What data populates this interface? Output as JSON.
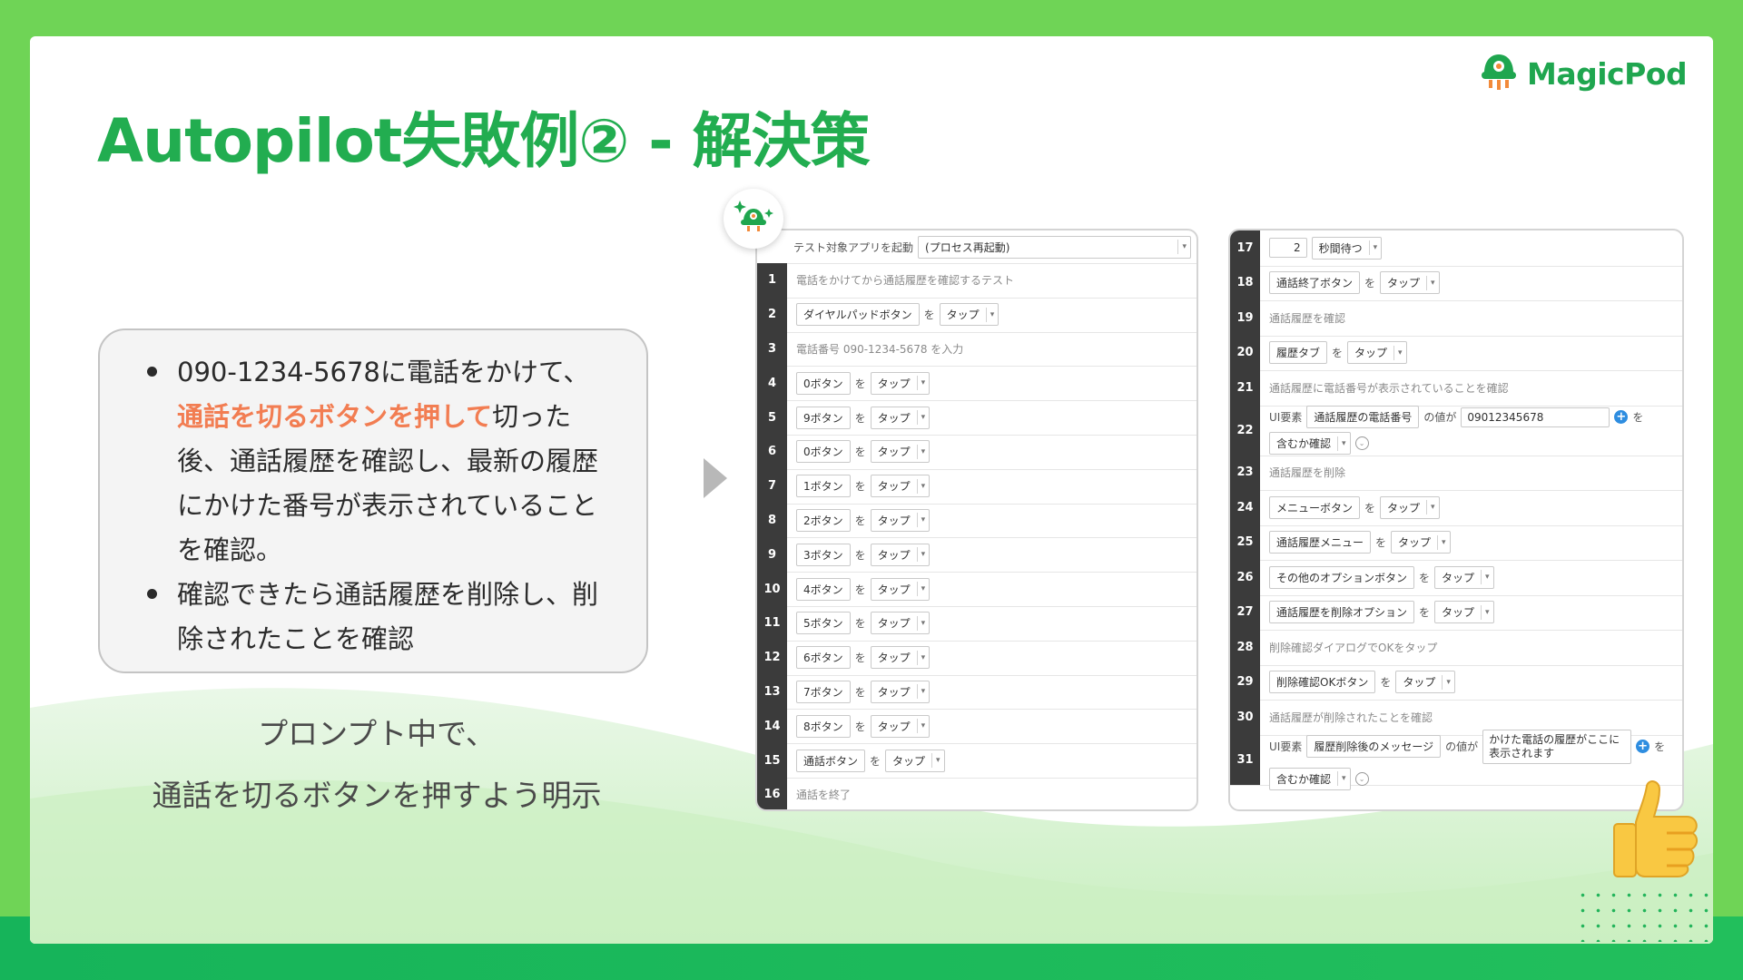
{
  "logo": {
    "text": "MagicPod"
  },
  "title": "Autopilot失敗例② - 解決策",
  "bullets": {
    "b1_pre": "090-1234-5678に電話をかけて、",
    "b1_highlight": "通話を切るボタンを押して",
    "b1_post": "切った後、通話履歴を確認し、最新の履歴にかけた番号が表示されていることを確認。",
    "b2": "確認できたら通話履歴を削除し、削除されたことを確認"
  },
  "caption": {
    "line1": "プロンプト中で、",
    "line2": "通話を切るボタンを押すよう明示"
  },
  "colors": {
    "title_green": "#22ad50",
    "highlight_orange": "#f27d52",
    "bg_green": "#6fd456"
  },
  "left_panel": {
    "launch": {
      "label": "テスト対象アプリを起動",
      "option": "(プロセス再起動)"
    },
    "steps": [
      {
        "n": "1",
        "comment": "電話をかけてから通話履歴を確認するテスト"
      },
      {
        "n": "2",
        "element": "ダイヤルパッドボタン",
        "wo": "を",
        "action": "タップ"
      },
      {
        "n": "3",
        "comment": "電話番号 090-1234-5678 を入力"
      },
      {
        "n": "4",
        "element": "0ボタン",
        "wo": "を",
        "action": "タップ"
      },
      {
        "n": "5",
        "element": "9ボタン",
        "wo": "を",
        "action": "タップ"
      },
      {
        "n": "6",
        "element": "0ボタン",
        "wo": "を",
        "action": "タップ"
      },
      {
        "n": "7",
        "element": "1ボタン",
        "wo": "を",
        "action": "タップ"
      },
      {
        "n": "8",
        "element": "2ボタン",
        "wo": "を",
        "action": "タップ"
      },
      {
        "n": "9",
        "element": "3ボタン",
        "wo": "を",
        "action": "タップ"
      },
      {
        "n": "10",
        "element": "4ボタン",
        "wo": "を",
        "action": "タップ"
      },
      {
        "n": "11",
        "element": "5ボタン",
        "wo": "を",
        "action": "タップ"
      },
      {
        "n": "12",
        "element": "6ボタン",
        "wo": "を",
        "action": "タップ"
      },
      {
        "n": "13",
        "element": "7ボタン",
        "wo": "を",
        "action": "タップ"
      },
      {
        "n": "14",
        "element": "8ボタン",
        "wo": "を",
        "action": "タップ"
      },
      {
        "n": "15",
        "element": "通話ボタン",
        "wo": "を",
        "action": "タップ"
      },
      {
        "n": "16",
        "comment": "通話を終了"
      }
    ]
  },
  "right_panel": {
    "steps": [
      {
        "n": "17",
        "wait_value": "2",
        "wait_label": "秒間待つ"
      },
      {
        "n": "18",
        "element": "通話終了ボタン",
        "wo": "を",
        "action": "タップ"
      },
      {
        "n": "19",
        "comment": "通話履歴を確認"
      },
      {
        "n": "20",
        "element": "履歴タブ",
        "wo": "を",
        "action": "タップ"
      },
      {
        "n": "21",
        "comment": "通話履歴に電話番号が表示されていることを確認"
      },
      {
        "n": "22",
        "ui_label": "UI要素",
        "element": "通話履歴の電話番号",
        "value_label": "の値が",
        "value": "09012345678",
        "wo": "を",
        "check": "含むか確認"
      },
      {
        "n": "23",
        "comment": "通話履歴を削除"
      },
      {
        "n": "24",
        "element": "メニューボタン",
        "wo": "を",
        "action": "タップ"
      },
      {
        "n": "25",
        "element": "通話履歴メニュー",
        "wo": "を",
        "action": "タップ"
      },
      {
        "n": "26",
        "element": "その他のオプションボタン",
        "wo": "を",
        "action": "タップ"
      },
      {
        "n": "27",
        "element": "通話履歴を削除オプション",
        "wo": "を",
        "action": "タップ"
      },
      {
        "n": "28",
        "comment": "削除確認ダイアログでOKをタップ"
      },
      {
        "n": "29",
        "element": "削除確認OKボタン",
        "wo": "を",
        "action": "タップ"
      },
      {
        "n": "30",
        "comment": "通話履歴が削除されたことを確認"
      },
      {
        "n": "31",
        "ui_label": "UI要素",
        "element": "履歴削除後のメッセージ",
        "value_label": "の値が",
        "value": "かけた電話の履歴がここに表示されます",
        "wo": "を",
        "check": "含むか確認"
      }
    ]
  },
  "icons": {
    "logo": "magicpod-logo-icon",
    "badge": "autopilot-badge-icon",
    "arrow": "arrow-right-icon",
    "thumb": "thumbs-up-icon",
    "caret": "▾",
    "plus": "+",
    "chevron": "⌄"
  }
}
